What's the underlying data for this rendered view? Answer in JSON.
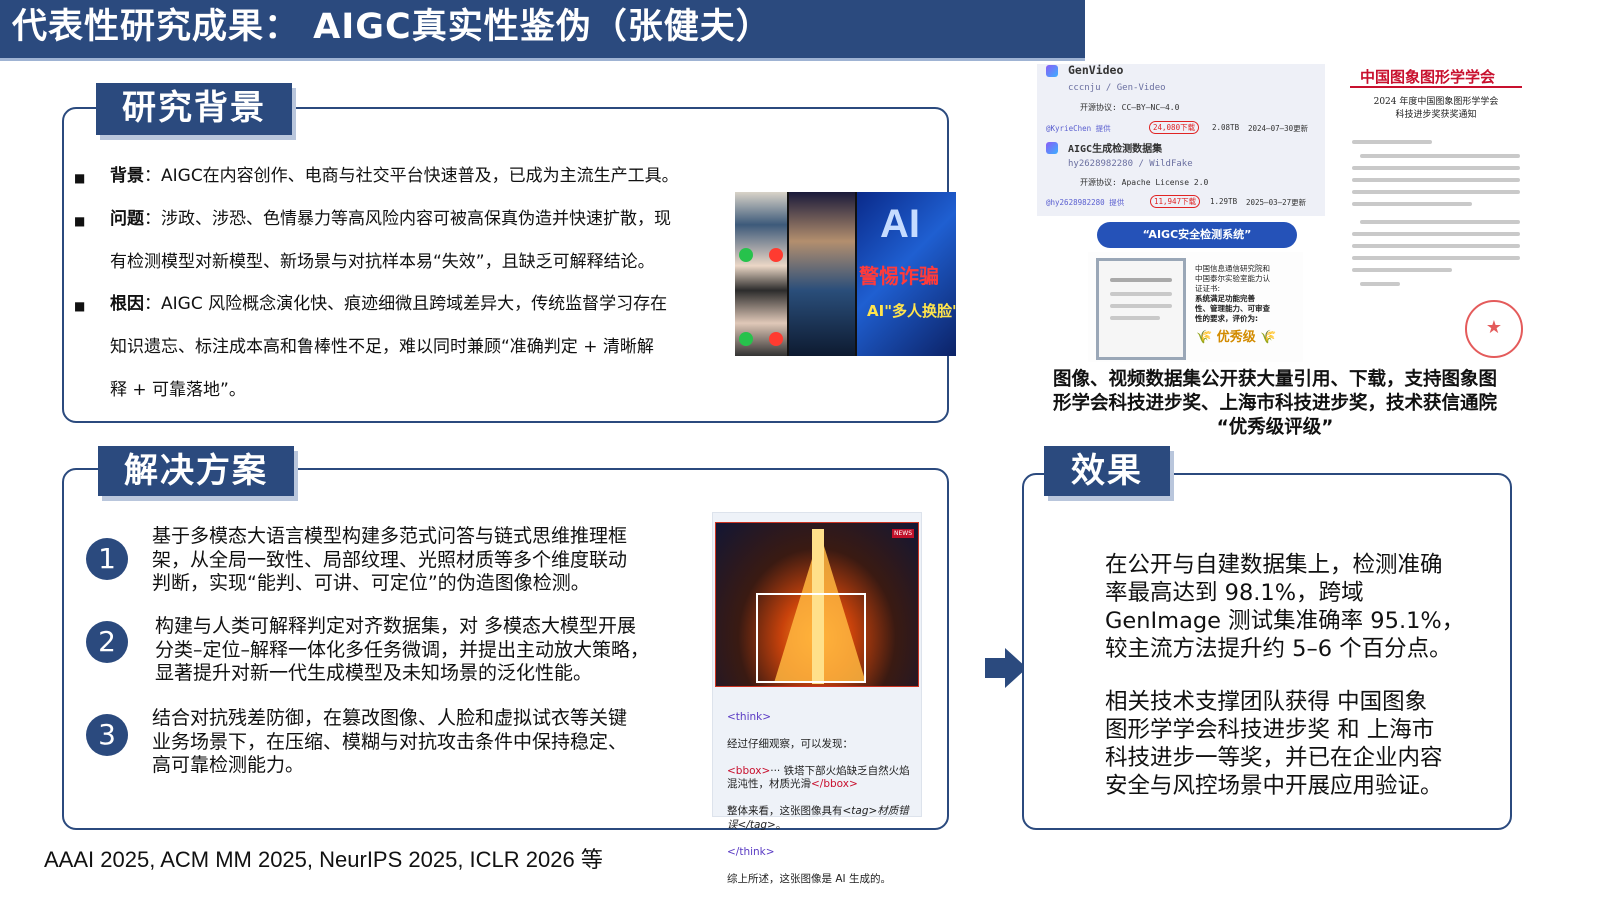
{
  "title": "代表性研究成果： AIGC真实性鉴伪（张健夫）",
  "background_section": {
    "heading": "研究背景",
    "bullets": [
      {
        "label": "背景",
        "lines": [
          "：AIGC在内容创作、电商与社交平台快速普及，已成为主流生产工具。"
        ]
      },
      {
        "label": "问题",
        "lines": [
          "：涉政、涉恐、色情暴力等高风险内容可被高保真伪造并快速扩散，现",
          "有检测模型对新模型、新场景与对抗样本易“失效”，且缺乏可解释结论。"
        ]
      },
      {
        "label": "根因",
        "lines": [
          "：AIGC 风险概念演化快、痕迹细微且跨域差异大，传统监督学习存在",
          "知识遗忘、标注成本高和鲁棒性不足，难以同时兼顾“准确判定 + 清晰解",
          "释 + 可靠落地”。"
        ]
      }
    ],
    "collage": {
      "overlay_big": "AI",
      "overlay_warn": "警惕诈骗",
      "overlay_sub": "AI\"多人换脸\""
    }
  },
  "solution_section": {
    "heading": "解决方案",
    "items": [
      {
        "number": "1",
        "text": "基于多模态大语言模型构建多范式问答与链式思维推理框\n架，从全局一致性、局部纹理、光照材质等多个维度联动\n判断，实现“能判、可讲、可定位”的伪造图像检测。"
      },
      {
        "number": "2",
        "text": "构建与人类可解释判定对齐数据集，对 多模态大模型开展\n分类–定位–解释一体化多任务微调，并提出主动放大策略，\n显著提升对新一代生成模型及未知场景的泛化性能。"
      },
      {
        "number": "3",
        "text": "结合对抗残差防御，在篡改图像、人脸和虚拟试衣等关键\n业务场景下，在压缩、模糊与对抗攻击条件中保持稳定、\n高可靠检测能力。"
      }
    ],
    "example": {
      "news_badge": "NEWS",
      "think_open": "<think>",
      "line1": "经过仔细观察，可以发现：",
      "bbox_open": "<bbox>",
      "line2": "··· 铁塔下部火焰缺乏自然火焰混沌性，材质光滑",
      "bbox_close": "</bbox>",
      "line3": "整体来看，这张图像具有",
      "tag_inner": "<tag>材质错误</tag>",
      "line3_end": "。",
      "think_close": "</think>",
      "conclusion": "综上所述，这张图像是 AI 生成的。"
    }
  },
  "effect_section": {
    "heading": "效果",
    "paragraph1": "在公开与自建数据集上，检测准确\n率最高达到 98.1%，跨域\nGenImage 测试集准确率 95.1%，\n较主流方法提升约 5–6 个百分点。",
    "paragraph2": "相关技术支撑团队获得 中国图象\n图形学学会科技进步奖 和 上海市\n科技进步一等奖，并已在企业内容\n安全与风控场景中开展应用验证。"
  },
  "evidence": {
    "dataset1": {
      "name": "GenVideo",
      "path": "cccnju / Gen-Video",
      "license": "开源协议: CC–BY–NC–4.0",
      "provider": "@KyrieChen 提供",
      "downloads": "24,080下载",
      "size": "2.08TB",
      "updated": "2024–07–30更新"
    },
    "dataset2": {
      "name": "AIGC生成检测数据集",
      "path": "hy2628982280 / WildFake",
      "license": "开源协议: Apache License 2.0",
      "provider": "@hy2628982280 提供",
      "downloads": "11,947下载",
      "size": "1.29TB",
      "updated": "2025–03–27更新"
    },
    "system_badge": "“AIGC安全检测系统”",
    "cert_text": "中国信息通信研究院和\n中国泰尔实验室能力认\n证证书:",
    "cert_eval": "系统满足功能完善\n性、管理能力、可审查\n性的要求，评价为:",
    "cert_grade": "优秀级",
    "letter_header": "中国图象图形学学会",
    "letter_subject": "2024 年度中国图象图形学学会\n科技进步奖获奖通知",
    "seal_glyph": "★",
    "caption": "图像、视频数据集公开获大量引用、下载，支持图象图\n形学会科技进步奖、上海市科技进步奖，技术获信通院\n“优秀级评级”"
  },
  "footer": "AAAI 2025, ACM MM 2025, NeurIPS 2025, ICLR 2026 等"
}
